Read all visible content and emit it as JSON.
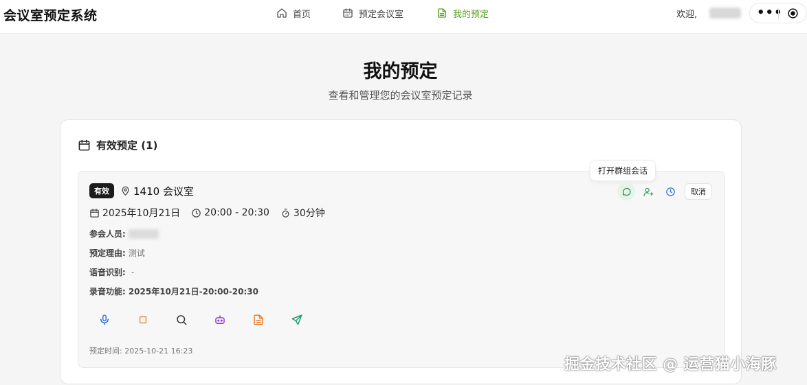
{
  "app": {
    "title": "会议室预定系统"
  },
  "nav": [
    {
      "label": "首页",
      "icon": "home-icon",
      "active": false
    },
    {
      "label": "预定会议室",
      "icon": "calendar-icon",
      "active": false
    },
    {
      "label": "我的预定",
      "icon": "document-icon",
      "active": true
    }
  ],
  "header": {
    "welcome": "欢迎,"
  },
  "page": {
    "title": "我的预定",
    "subtitle": "查看和管理您的会议室预定记录"
  },
  "section": {
    "title": "有效预定 (1)"
  },
  "booking": {
    "status": "有效",
    "room": "1410 会议室",
    "date": "2025年10月21日",
    "time": "20:00 - 20:30",
    "duration": "30分钟",
    "attendees_label": "参会人员:",
    "reason_label": "预定理由:",
    "reason": "测试",
    "speech_label": "语音识别:",
    "speech": "-",
    "recording_label": "录音功能:",
    "recording": "2025年10月21日-20:00-20:30",
    "booked_at": "预定时间: 2025-10-21 16:23",
    "tooltip": "打开群组会话",
    "cancel": "取消"
  },
  "colors": {
    "accent_green": "#5a9c1e",
    "mic_blue": "#2f6fdb",
    "stop_orange": "#f08a5d",
    "bot_purple": "#8b3fd1",
    "doc_orange": "#e8762c",
    "send_green": "#1e9e6a"
  },
  "watermark": "掘金技术社区 @ 运营猫小海豚"
}
